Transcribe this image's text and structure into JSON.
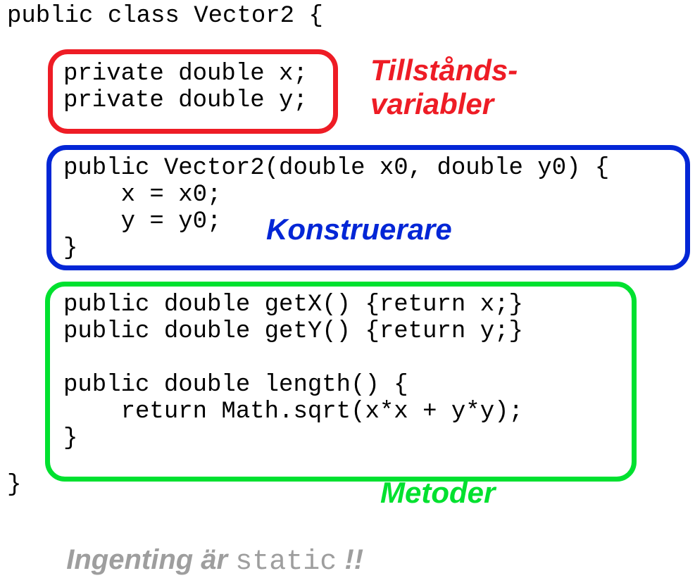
{
  "code": {
    "class_decl": "public class Vector2 {",
    "field_x": "private double x;",
    "field_y": "private double y;",
    "ctor_sig": "public Vector2(double x0, double y0) {",
    "ctor_body1": "    x = x0;",
    "ctor_body2": "    y = y0;",
    "ctor_close": "}",
    "method_getx": "public double getX() {return x;}",
    "method_gety": "public double getY() {return y;}",
    "method_len_sig": "public double length() {",
    "method_len_body": "    return Math.sqrt(x*x + y*y);",
    "method_len_close": "}",
    "class_close": "}"
  },
  "labels": {
    "state_vars": "Tillstånds-\nvariabler",
    "constructor": "Konstruerare",
    "methods": "Metoder",
    "footer_pre": "Ingenting är ",
    "footer_kw": "static",
    "footer_post": " !!"
  }
}
